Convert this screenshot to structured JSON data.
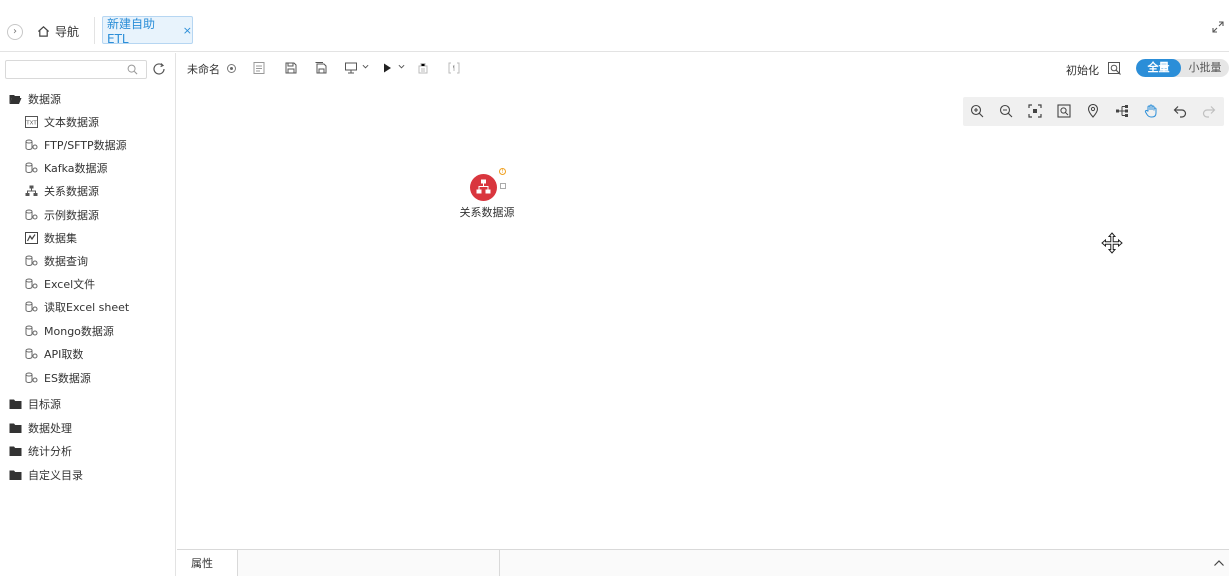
{
  "header": {
    "nav_label": "导航",
    "active_tab_label": "新建自助ETL",
    "active_tab_close": "×",
    "collapse_glyph": "›"
  },
  "sidebar": {
    "search": {
      "value": "",
      "placeholder": ""
    },
    "groups": [
      {
        "label": "数据源",
        "expanded": true,
        "children": [
          {
            "label": "文本数据源",
            "icon": "text-file-icon"
          },
          {
            "label": "FTP/SFTP数据源",
            "icon": "ftp-icon"
          },
          {
            "label": "Kafka数据源",
            "icon": "kafka-icon"
          },
          {
            "label": "关系数据源",
            "icon": "relational-db-icon"
          },
          {
            "label": "示例数据源",
            "icon": "sample-db-icon"
          },
          {
            "label": "数据集",
            "icon": "dataset-icon"
          },
          {
            "label": "数据查询",
            "icon": "query-icon"
          },
          {
            "label": "Excel文件",
            "icon": "excel-icon"
          },
          {
            "label": "读取Excel sheet",
            "icon": "excel-sheet-icon"
          },
          {
            "label": "Mongo数据源",
            "icon": "mongo-icon"
          },
          {
            "label": "API取数",
            "icon": "api-icon"
          },
          {
            "label": "ES数据源",
            "icon": "es-icon"
          }
        ]
      },
      {
        "label": "目标源",
        "expanded": false
      },
      {
        "label": "数据处理",
        "expanded": false
      },
      {
        "label": "统计分析",
        "expanded": false
      },
      {
        "label": "自定义目录",
        "expanded": false
      }
    ]
  },
  "toolbar": {
    "doc_title": "未命名",
    "init_label": "初始化",
    "mode_full": "全量",
    "mode_micro": "小批量",
    "mode_selected": "全量"
  },
  "canvas": {
    "node": {
      "label": "关系数据源",
      "status": "warning"
    }
  },
  "bottom_panel": {
    "tab_label": "属性"
  },
  "colors": {
    "accent": "#2b8ed8",
    "tab_bg": "#e8f3fc",
    "node_red": "#d9363e",
    "warning": "#f0a020"
  }
}
